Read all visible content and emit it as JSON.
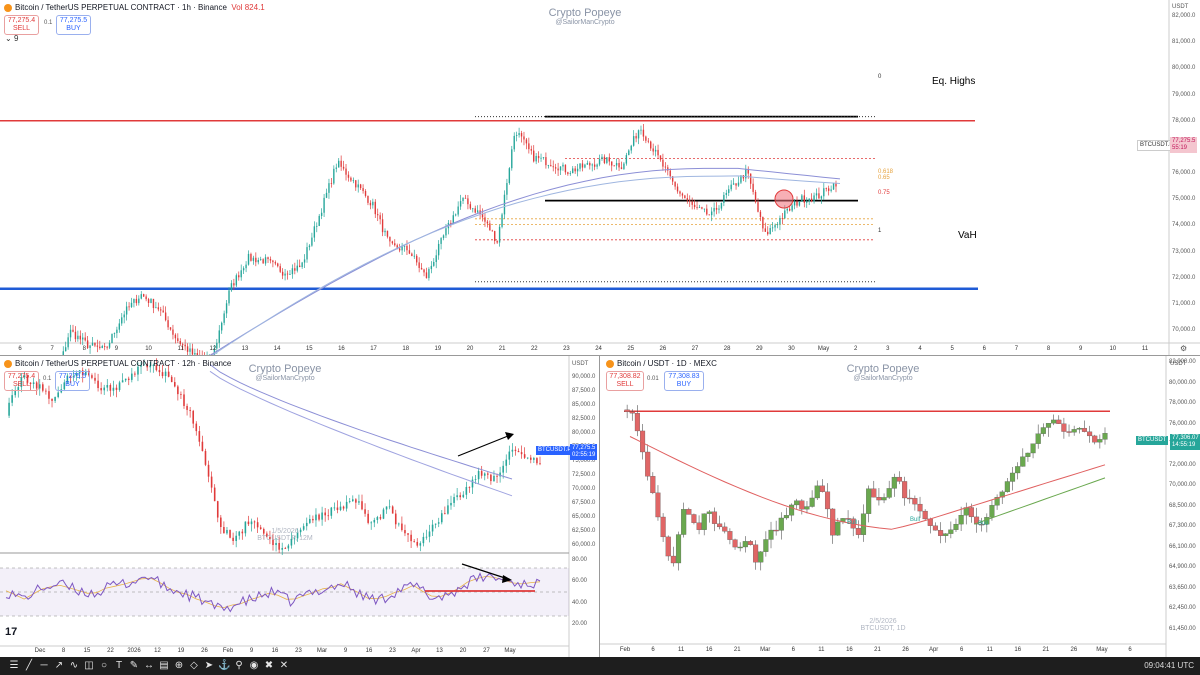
{
  "top": {
    "title": "Bitcoin / TetherUS PERPETUAL CONTRACT · 1h · Binance",
    "vol": "Vol 824.1",
    "sell_price": "77,275.4",
    "sell_label": "SELL",
    "buy_price": "77,275.5",
    "buy_label": "BUY",
    "spread": "0.1",
    "indicator_count": "9",
    "brand": "Crypto Popeye",
    "handle": "@SailorManCrypto",
    "currency": "USDT",
    "price_ticks": [
      "82,000.0",
      "81,000.0",
      "80,000.0",
      "79,000.0",
      "78,000.0",
      "77,000.0",
      "76,000.0",
      "75,000.0",
      "74,000.0",
      "73,000.0",
      "72,000.0",
      "71,000.0",
      "70,000.0"
    ],
    "time_ticks": [
      "6",
      "7",
      "8",
      "9",
      "10",
      "11",
      "12",
      "13",
      "14",
      "15",
      "16",
      "17",
      "18",
      "19",
      "20",
      "21",
      "22",
      "23",
      "24",
      "25",
      "26",
      "27",
      "28",
      "29",
      "30",
      "May",
      "2",
      "3",
      "4",
      "5",
      "6",
      "7",
      "8",
      "9",
      "10",
      "11"
    ],
    "symbol_tag": "BTCUSDT.P",
    "last_price": "77,275.5",
    "countdown": "55:19",
    "label_eq_highs": "Eq. Highs",
    "label_vah": "VaH",
    "fib_0": "0",
    "fib_618": "0.618",
    "fib_65": "0.65",
    "fib_75": "0.75",
    "fib_1": "1"
  },
  "bl": {
    "title": "Bitcoin / TetherUS PERPETUAL CONTRACT · 12h · Binance",
    "sell_price": "77,275.4",
    "sell_label": "SELL",
    "buy_price": "77,275.5",
    "buy_label": "BUY",
    "spread": "0.1",
    "brand": "Crypto Popeye",
    "handle": "@SailorManCrypto",
    "currency": "USDT",
    "price_ticks": [
      "90,000.0",
      "87,500.0",
      "85,000.0",
      "82,500.0",
      "80,000.0",
      "77,500.0",
      "75,000.0",
      "72,500.0",
      "70,000.0",
      "67,500.0",
      "65,000.0",
      "62,500.0",
      "60,000.0"
    ],
    "rsi_ticks": [
      "80.00",
      "60.00",
      "40.00",
      "20.00"
    ],
    "time_ticks": [
      "Dec",
      "8",
      "15",
      "22",
      "2026",
      "12",
      "19",
      "26",
      "Feb",
      "9",
      "16",
      "23",
      "Mar",
      "9",
      "16",
      "23",
      "Apr",
      "13",
      "20",
      "27",
      "May"
    ],
    "symbol_tag": "BTCUSDT.P",
    "last_price": "77,275.5",
    "countdown": "02:55:19",
    "wm_date": "1/5/2026",
    "wm_sym": "BTCUSDT.P, 12M"
  },
  "br": {
    "title": "Bitcoin / USDT · 1D · MEXC",
    "sell_price": "77,308.82",
    "sell_label": "SELL",
    "buy_price": "77,308.83",
    "buy_label": "BUY",
    "spread": "0.01",
    "brand": "Crypto Popeye",
    "handle": "@SailorManCrypto",
    "currency": "USDT",
    "price_ticks": [
      "82,000.00",
      "80,000.00",
      "78,000.00",
      "76,000.00",
      "74,000.00",
      "72,000.00",
      "70,000.00",
      "68,500.00",
      "67,300.00",
      "66,100.00",
      "64,900.00",
      "63,650.00",
      "62,450.00",
      "61,450.00"
    ],
    "time_ticks": [
      "Feb",
      "6",
      "11",
      "16",
      "21",
      "Mar",
      "6",
      "11",
      "16",
      "21",
      "26",
      "Apr",
      "6",
      "11",
      "16",
      "21",
      "26",
      "May",
      "6"
    ],
    "symbol_tag": "BTCUSDT",
    "last_price": "77,306.07",
    "countdown": "14:55:19",
    "wm_date": "2/5/2026",
    "wm_sym": "BTCUSDT, 1D",
    "label_bull_1": "Bull",
    "label_bull_2": "Bull",
    "label_bull_3": "Bull"
  },
  "toolbar": {
    "clock": "09:04:41 UTC",
    "icons": [
      "chart-icon",
      "line-tool-icon",
      "horizontal-line-icon",
      "trend-icon",
      "path-icon",
      "fib-icon",
      "circle-icon",
      "text-icon",
      "brush-icon",
      "measure-icon",
      "ruler-icon",
      "zoom-icon",
      "pattern-icon",
      "arrow-icon",
      "magnet-icon",
      "lock-icon",
      "eye-icon",
      "cross-icon",
      "trash-icon"
    ]
  },
  "colors": {
    "red": "#e03a3a",
    "blue": "#1f5bd6",
    "candle_up": "#26a69a",
    "candle_down": "#e03a3a",
    "ma_purple": "#8c8fd6",
    "rsi_purple": "#7e57c2"
  }
}
